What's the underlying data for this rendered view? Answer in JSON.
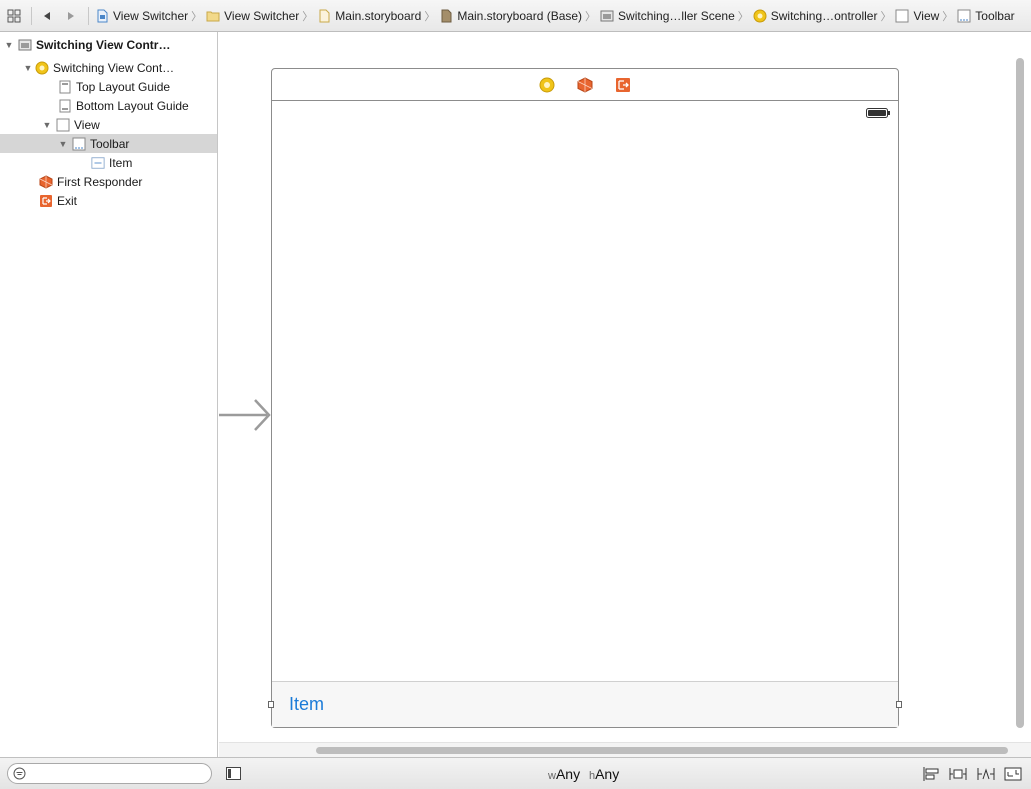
{
  "jumpbar": {
    "breadcrumbs": [
      {
        "label": "View Switcher",
        "icon": "project-file-icon"
      },
      {
        "label": "View Switcher",
        "icon": "folder-icon"
      },
      {
        "label": "Main.storyboard",
        "icon": "storyboard-file-icon"
      },
      {
        "label": "Main.storyboard (Base)",
        "icon": "storyboard-base-icon"
      },
      {
        "label": "Switching…ller Scene",
        "icon": "scene-icon"
      },
      {
        "label": "Switching…ontroller",
        "icon": "view-controller-icon"
      },
      {
        "label": "View",
        "icon": "view-icon"
      },
      {
        "label": "Toolbar",
        "icon": "toolbar-icon"
      }
    ]
  },
  "outline": {
    "items": [
      {
        "label": "Switching View Contr…",
        "icon": "scene-icon",
        "bold": true
      },
      {
        "label": "Switching View Cont…",
        "icon": "view-controller-icon"
      },
      {
        "label": "Top Layout Guide",
        "icon": "layout-guide-icon"
      },
      {
        "label": "Bottom Layout Guide",
        "icon": "layout-guide-icon"
      },
      {
        "label": "View",
        "icon": "view-icon"
      },
      {
        "label": "Toolbar",
        "icon": "toolbar-icon",
        "selected": true
      },
      {
        "label": "Item",
        "icon": "bar-button-item-icon"
      },
      {
        "label": "First Responder",
        "icon": "first-responder-icon"
      },
      {
        "label": "Exit",
        "icon": "exit-icon"
      }
    ]
  },
  "canvas": {
    "toolbar_item_label": "Item"
  },
  "bottombar": {
    "filter_value": "",
    "size_class": {
      "w_prefix": "w",
      "w_value": "Any",
      "h_prefix": "h",
      "h_value": "Any"
    }
  },
  "colors": {
    "selection": "#d6d6d6",
    "item_blue": "#1b7bd8",
    "view_controller_yellow": "#f0c419",
    "first_responder_orange": "#e8652f",
    "exit_orange": "#e8652f"
  }
}
